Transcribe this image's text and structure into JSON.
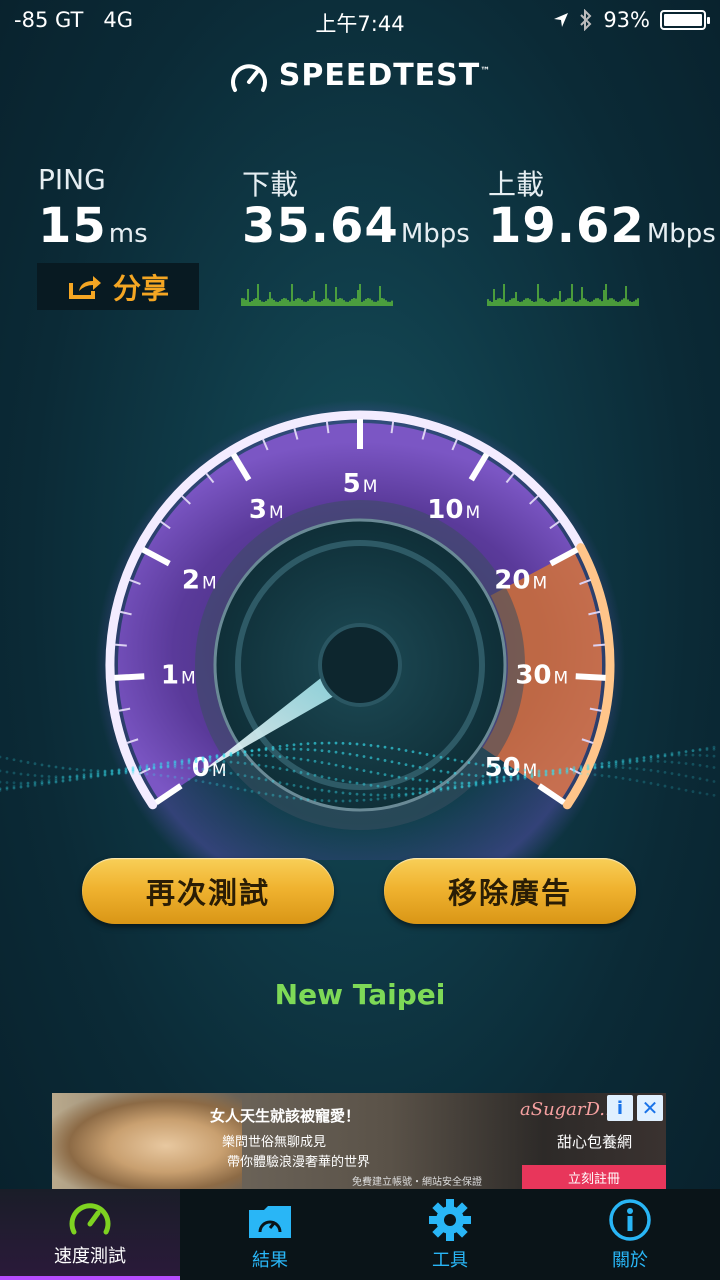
{
  "status_bar": {
    "signal": "-85 GT",
    "network": "4G",
    "time": "上午7:44",
    "battery": "93%"
  },
  "app": {
    "title": "SPEEDTEST",
    "trademark": "™"
  },
  "metrics": {
    "ping": {
      "label": "PING",
      "value": "15",
      "unit": "ms"
    },
    "download": {
      "label": "下載",
      "value": "35.64",
      "unit": "Mbps"
    },
    "upload": {
      "label": "上載",
      "value": "19.62",
      "unit": "Mbps"
    }
  },
  "share_button": {
    "label": "分享"
  },
  "gauge": {
    "ticks": [
      {
        "value": "0",
        "unit": "M"
      },
      {
        "value": "1",
        "unit": "M"
      },
      {
        "value": "2",
        "unit": "M"
      },
      {
        "value": "3",
        "unit": "M"
      },
      {
        "value": "5",
        "unit": "M"
      },
      {
        "value": "10",
        "unit": "M"
      },
      {
        "value": "20",
        "unit": "M"
      },
      {
        "value": "30",
        "unit": "M"
      },
      {
        "value": "50",
        "unit": "M"
      }
    ],
    "needle_value_mbps": 0
  },
  "buttons": {
    "retest": "再次測試",
    "remove_ads": "移除廣告"
  },
  "location": "New Taipei",
  "ad": {
    "headline": "女人天生就該被寵愛！",
    "line1": "樂問世俗無聊成見",
    "line2": "帶你體驗浪漫奢華的世界",
    "footer": "免費建立帳號・網站安全保證",
    "brand": "aSugarD...",
    "subtitle": "甜心包養網",
    "cta": "立刻註冊"
  },
  "tabs": [
    {
      "label": "速度測試",
      "icon": "speedometer-icon",
      "active": true
    },
    {
      "label": "結果",
      "icon": "results-folder-icon",
      "active": false
    },
    {
      "label": "工具",
      "icon": "gear-icon",
      "active": false
    },
    {
      "label": "關於",
      "icon": "info-icon",
      "active": false
    }
  ],
  "colors": {
    "accent_orange": "#f5a623",
    "button_gold": "#f0b330",
    "location_green": "#7ed957",
    "tab_blue": "#29b6f6",
    "active_purple": "#b64cff",
    "gauge_purple": "#6a3aa8",
    "gauge_orange": "#e0782a"
  }
}
